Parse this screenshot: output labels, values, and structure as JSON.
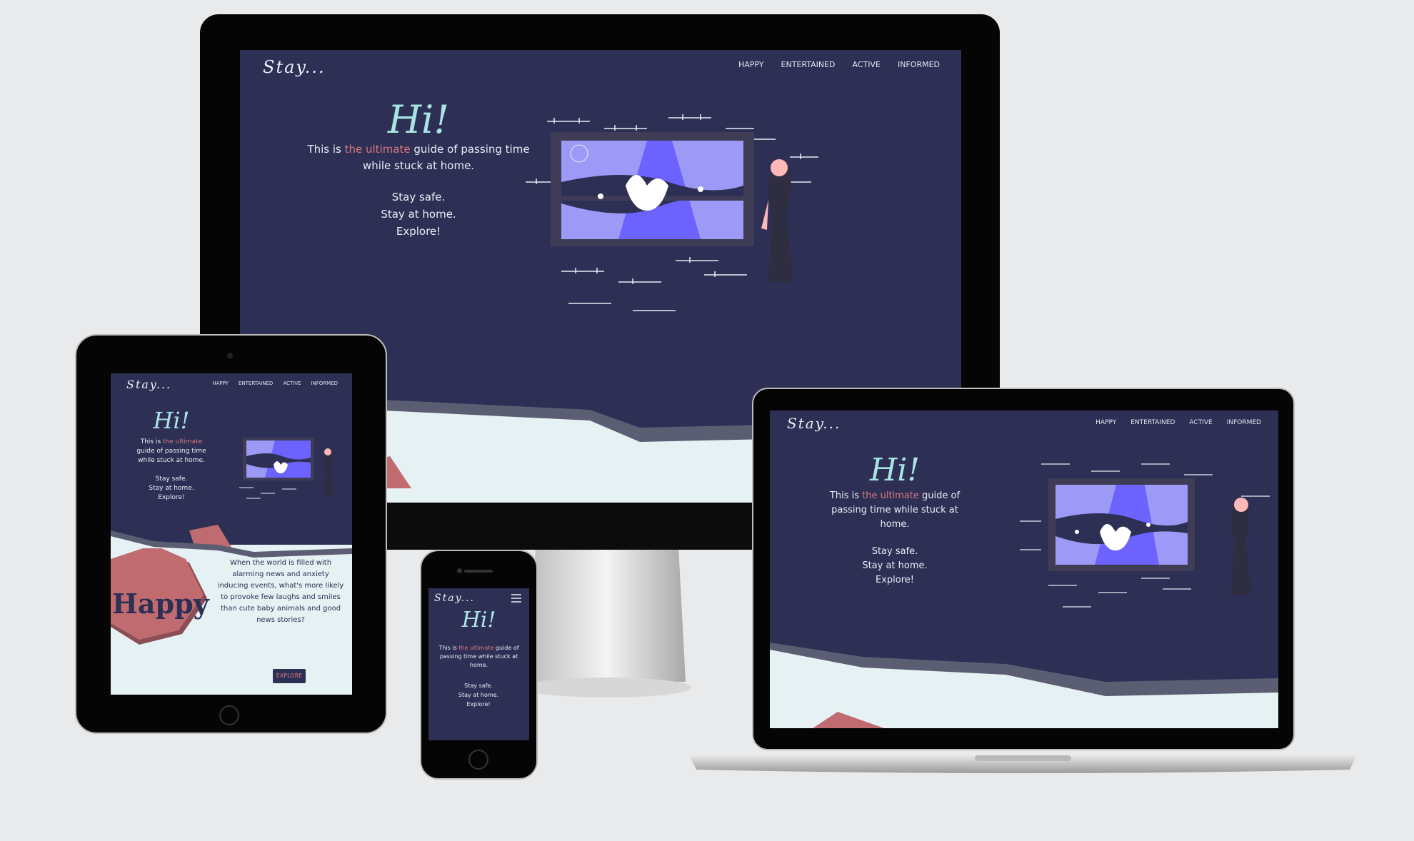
{
  "site": {
    "brand": "Stay...",
    "nav": [
      "HAPPY",
      "ENTERTAINED",
      "ACTIVE",
      "INFORMED"
    ],
    "hero_title": "Hi!",
    "intro_before": "This is ",
    "intro_accent": "the ultimate",
    "intro_after": " guide of passing time while stuck at home.",
    "line1": "Stay safe.",
    "line2": "Stay at home.",
    "line3": "Explore!"
  },
  "happy_section": {
    "heading": "Happy",
    "text": "When the world is filled with alarming news and anxiety inducing events, what's more likely to provoke few laughs and smiles than cute baby animals and good news stories?",
    "button": "EXPLORE"
  },
  "colors": {
    "background": "#2d2f55",
    "accent": "#d9797e",
    "heading": "#a9e4e4",
    "light_band": "#e5f1f2",
    "illustration": "#6c63ff"
  },
  "icons": [
    "menu-icon"
  ]
}
